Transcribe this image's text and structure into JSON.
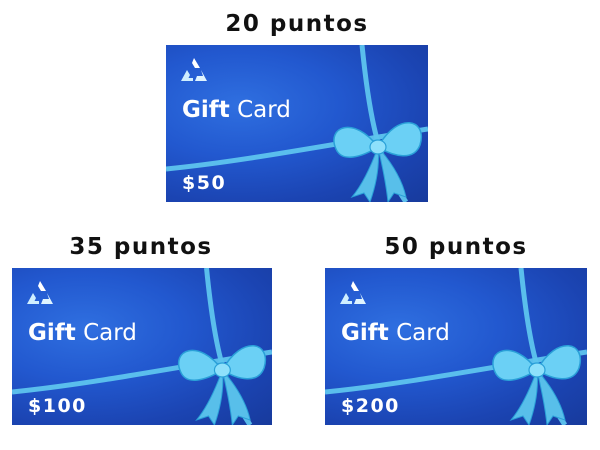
{
  "cards": [
    {
      "points": "20 puntos",
      "title_main": "Gift",
      "title_rest": "Card",
      "value": "$50",
      "logo": "triangle-recycle-logo-icon"
    },
    {
      "points": "35 puntos",
      "title_main": "Gift",
      "title_rest": "Card",
      "value": "$100",
      "logo": "triangle-recycle-logo-icon"
    },
    {
      "points": "50 puntos",
      "title_main": "Gift",
      "title_rest": "Card",
      "value": "$200",
      "logo": "triangle-recycle-logo-icon"
    }
  ],
  "colors": {
    "card_blue": "#2258cf",
    "ribbon": "#5ec4ee",
    "text_dark": "#111111",
    "text_light": "#ffffff"
  }
}
